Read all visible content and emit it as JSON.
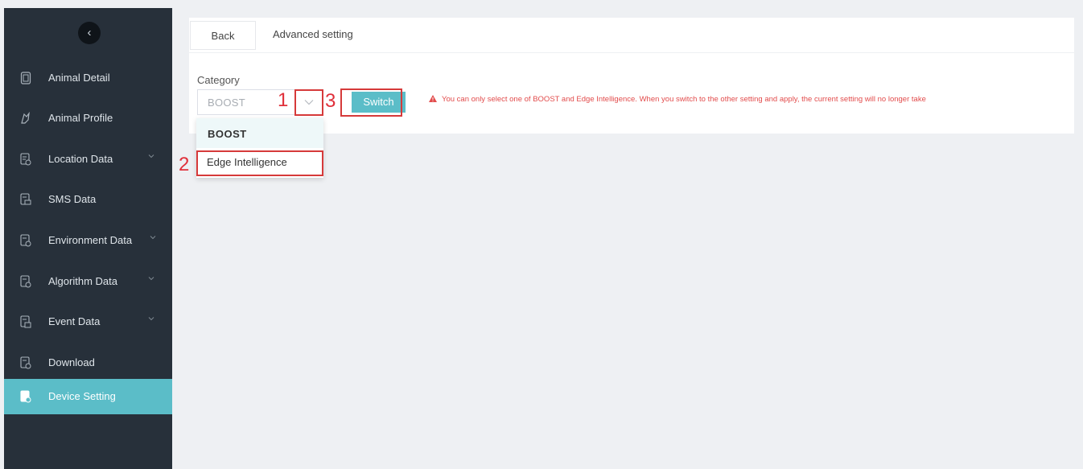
{
  "sidebar": {
    "collapse_icon": "chevron-left-icon",
    "items": [
      {
        "label": "Animal Detail",
        "icon": "document-icon",
        "has_submenu": false,
        "active": false
      },
      {
        "label": "Animal Profile",
        "icon": "animal-icon",
        "has_submenu": false,
        "active": false
      },
      {
        "label": "Location Data",
        "icon": "data-location-icon",
        "has_submenu": true,
        "active": false
      },
      {
        "label": "SMS Data",
        "icon": "data-sms-icon",
        "has_submenu": false,
        "active": false
      },
      {
        "label": "Environment Data",
        "icon": "data-environment-icon",
        "has_submenu": true,
        "active": false
      },
      {
        "label": "Algorithm Data",
        "icon": "data-algorithm-icon",
        "has_submenu": true,
        "active": false
      },
      {
        "label": "Event Data",
        "icon": "data-event-icon",
        "has_submenu": true,
        "active": false
      },
      {
        "label": "Download",
        "icon": "data-download-icon",
        "has_submenu": false,
        "active": false
      },
      {
        "label": "Device Setting",
        "icon": "device-setting-icon",
        "has_submenu": false,
        "active": true
      }
    ]
  },
  "header": {
    "back_label": "Back",
    "title": "Advanced setting"
  },
  "form": {
    "category_label": "Category",
    "category_value": "BOOST",
    "switch_label": "Switch",
    "warning_text": "You can only select one of BOOST and Edge Intelligence. When you switch to the other setting and apply, the current setting will no longer take"
  },
  "dropdown": {
    "options": [
      "BOOST",
      "Edge Intelligence"
    ],
    "highlighted": "BOOST"
  },
  "annotations": {
    "step1": "1",
    "step2": "2",
    "step3": "3"
  },
  "colors": {
    "sidebar_bg": "#27303a",
    "accent": "#5bbdc8",
    "warning": "#e24c4c",
    "annotation": "#e0303a"
  }
}
